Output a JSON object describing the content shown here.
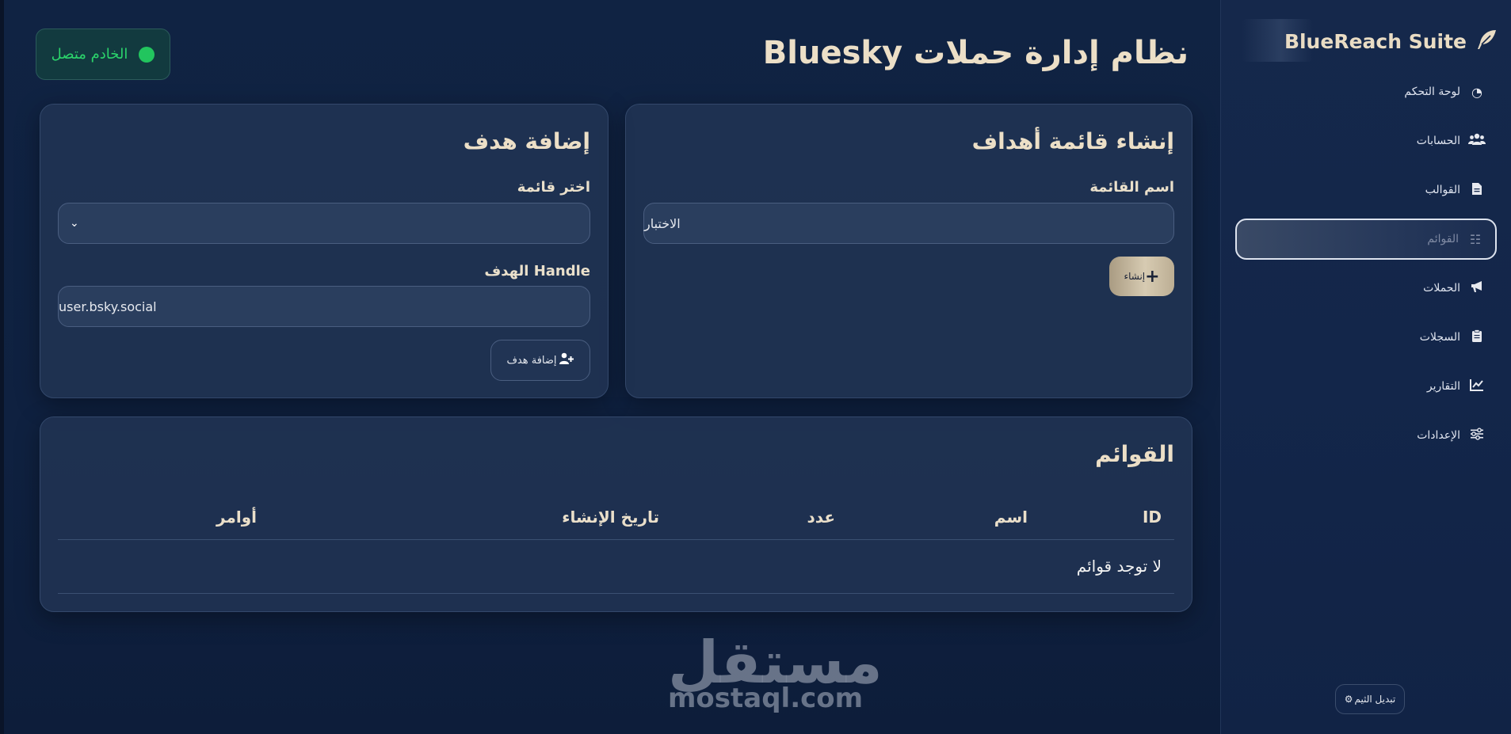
{
  "sidebar": {
    "brand": "BlueReach Suite",
    "items": [
      {
        "label": "لوحة التحكم",
        "icon": "dashboard-icon"
      },
      {
        "label": "الحسابات",
        "icon": "users-icon"
      },
      {
        "label": "القوالب",
        "icon": "file-icon"
      },
      {
        "label": "القوائم",
        "icon": "list-check-icon",
        "active": true
      },
      {
        "label": "الحملات",
        "icon": "megaphone-icon"
      },
      {
        "label": "السجلات",
        "icon": "clipboard-icon"
      },
      {
        "label": "التقارير",
        "icon": "chart-line-icon"
      },
      {
        "label": "الإعدادات",
        "icon": "sliders-icon"
      }
    ],
    "theme_button": "تبديل الثيم"
  },
  "header": {
    "title": "نظام إدارة حملات Bluesky",
    "status": "الخادم متصل",
    "status_color": "#22c55e"
  },
  "create_list": {
    "title": "إنشاء قائمة أهداف",
    "name_label": "اسم القائمة",
    "name_value": "الاختبار",
    "button": "إنشاء"
  },
  "add_target": {
    "title": "إضافة هدف",
    "select_label": "اختر قائمة",
    "select_value": "",
    "handle_label": "Handle الهدف",
    "handle_value": "user.bsky.social",
    "button": "إضافة هدف"
  },
  "lists_table": {
    "title": "القوائم",
    "columns": [
      "ID",
      "اسم",
      "عدد",
      "تاريخ الإنشاء",
      "أوامر"
    ],
    "empty_message": "لا توجد قوائم"
  },
  "watermark": {
    "arabic": "مستقل",
    "latin": "mostaql.com"
  },
  "colors": {
    "accent_gold": "#d7cbb2",
    "status_green": "#22c55e",
    "background": "#0f2140"
  }
}
